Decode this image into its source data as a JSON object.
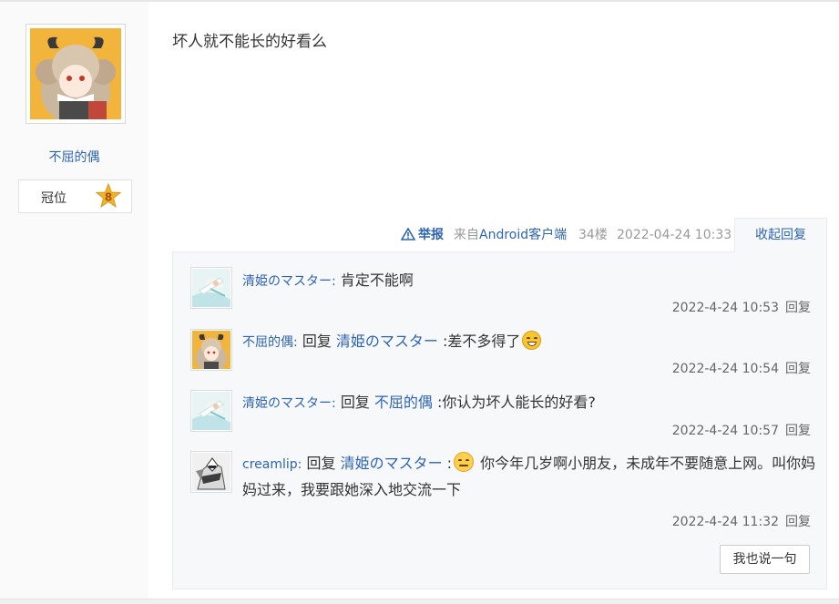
{
  "post": {
    "author": {
      "name": "不屈的偶",
      "badge_label": "冠位",
      "level": "8"
    },
    "content": "坏人就不能长的好看么",
    "meta": {
      "report_label": "举报",
      "source_prefix": "来自",
      "source_client": "Android客户端",
      "floor": "34楼",
      "time": "2022-04-24 10:33",
      "collapse_label": "收起回复"
    }
  },
  "replies": [
    {
      "user": "清姫のマスター:",
      "reply_prefix": "",
      "reply_to": "",
      "text": "肯定不能啊",
      "text2": "",
      "time": "2022-4-24 10:53",
      "reply_label": "回复",
      "avatar": "anime-girl-white-avatar"
    },
    {
      "user": "不屈的偶:",
      "reply_prefix": "回复",
      "reply_to": "清姫のマスター",
      "text": ":差不多得了",
      "text2": "",
      "time": "2022-4-24 10:54",
      "reply_label": "回复",
      "avatar": "anime-girl-horns-avatar",
      "emoji": "sweat-smile-emoji"
    },
    {
      "user": "清姫のマスター:",
      "reply_prefix": "回复",
      "reply_to": "不屈的偶",
      "text": ":你认为坏人能长的好看?",
      "text2": "",
      "time": "2022-4-24 10:57",
      "reply_label": "回复",
      "avatar": "anime-girl-white-avatar"
    },
    {
      "user": "creamlip:",
      "reply_prefix": "回复",
      "reply_to": "清姫のマスター",
      "text": ":",
      "text2": "你今年几岁啊小朋友，未成年不要随意上网。叫你妈妈过来，我要跟她深入地交流一下",
      "time": "2022-4-24 11:32",
      "reply_label": "回复",
      "avatar": "robot-mecha-avatar",
      "emoji": "smirk-emoji"
    }
  ],
  "say_button": "我也说一句",
  "colors": {
    "link": "#2d64b3",
    "meta": "#999999",
    "panel_bg": "#f7f8fa",
    "badge_gold": "#f0b429"
  }
}
